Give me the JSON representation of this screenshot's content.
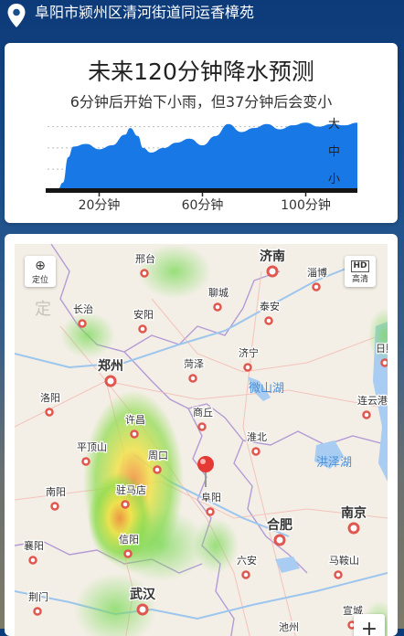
{
  "location": {
    "address": "阜阳市颍州区清河街道同运香樟苑",
    "icon": "location-pin-icon"
  },
  "forecast": {
    "title": "未来120分钟降水预测",
    "subtitle": "6分钟后开始下小雨，但37分钟后会变小",
    "levels": {
      "heavy": "大",
      "medium": "中",
      "light": "小"
    },
    "x_ticks": [
      "20分钟",
      "60分钟",
      "100分钟"
    ]
  },
  "chart_data": {
    "type": "area",
    "x": [
      0,
      4,
      6,
      8,
      10,
      15,
      20,
      25,
      30,
      32,
      35,
      37,
      40,
      45,
      50,
      55,
      60,
      65,
      70,
      75,
      80,
      85,
      90,
      95,
      100,
      105,
      110,
      115,
      120
    ],
    "values": [
      0,
      0,
      0.1,
      0.48,
      0.64,
      0.68,
      0.6,
      0.66,
      0.82,
      0.92,
      0.8,
      0.62,
      0.55,
      0.62,
      0.7,
      0.76,
      0.66,
      0.8,
      0.98,
      0.86,
      0.92,
      0.98,
      0.9,
      0.96,
      1.0,
      0.94,
      0.98,
      0.96,
      1.0
    ],
    "ylim": [
      0,
      1.1
    ],
    "xlim": [
      0,
      120
    ],
    "y_labels": [
      "小",
      "中",
      "大"
    ],
    "xticks": [
      20,
      60,
      100
    ],
    "color": "#1778e6",
    "grid": true
  },
  "map": {
    "locate_label": "定位",
    "hd_label": "高清",
    "zoom_in": "+",
    "cities": [
      {
        "name": "济南",
        "big": true
      },
      {
        "name": "邢台",
        "big": false
      },
      {
        "name": "淄博",
        "big": false
      },
      {
        "name": "聊城",
        "big": false
      },
      {
        "name": "长治",
        "big": false
      },
      {
        "name": "安阳",
        "big": false
      },
      {
        "name": "泰安",
        "big": false
      },
      {
        "name": "日照",
        "big": false
      },
      {
        "name": "郑州",
        "big": true
      },
      {
        "name": "菏泽",
        "big": false
      },
      {
        "name": "济宁",
        "big": false
      },
      {
        "name": "洛阳",
        "big": false
      },
      {
        "name": "商丘",
        "big": false
      },
      {
        "name": "连云港",
        "big": false
      },
      {
        "name": "许昌",
        "big": false
      },
      {
        "name": "淮北",
        "big": false
      },
      {
        "name": "平顶山",
        "big": false
      },
      {
        "name": "周口",
        "big": false
      },
      {
        "name": "南阳",
        "big": false
      },
      {
        "name": "驻马店",
        "big": false
      },
      {
        "name": "阜阳",
        "big": false
      },
      {
        "name": "合肥",
        "big": true
      },
      {
        "name": "南京",
        "big": true
      },
      {
        "name": "信阳",
        "big": false
      },
      {
        "name": "六安",
        "big": false
      },
      {
        "name": "马鞍山",
        "big": false
      },
      {
        "name": "荆门",
        "big": false
      },
      {
        "name": "武汉",
        "big": true
      },
      {
        "name": "宣城",
        "big": false
      },
      {
        "name": "池州",
        "big": false
      },
      {
        "name": "襄阳",
        "big": false
      }
    ],
    "water": [
      {
        "name": "微山湖"
      },
      {
        "name": "洪泽湖"
      }
    ],
    "watermark": "定"
  },
  "colors": {
    "accent": "#1778e6",
    "header_bg": "#0d3a78",
    "rain_light": "#5cd65c",
    "rain_mid": "#f2e24a",
    "rain_heavy": "#f08a3c"
  }
}
